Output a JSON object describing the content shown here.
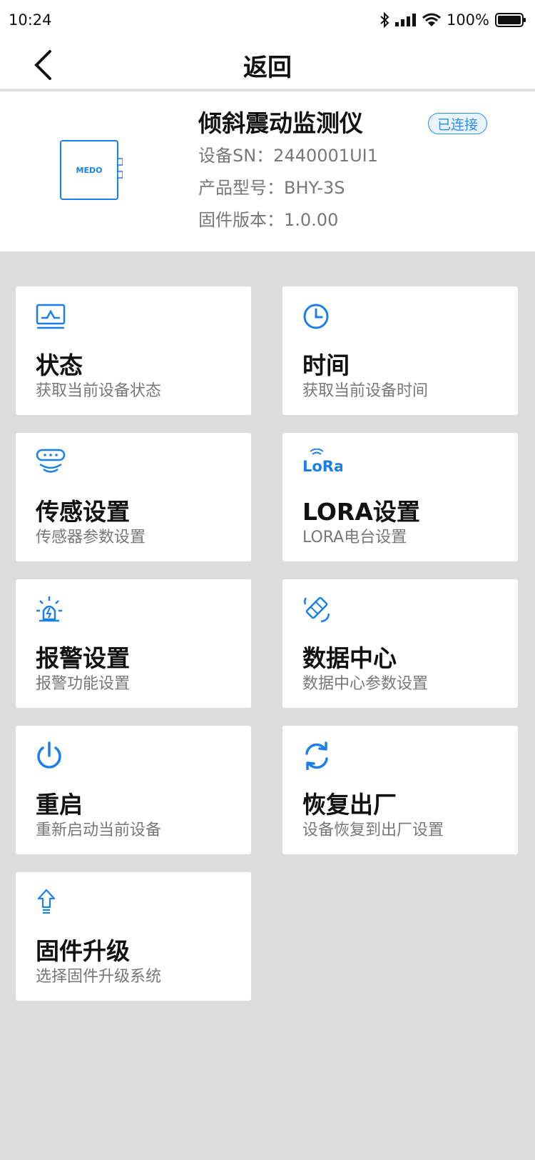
{
  "status_bar": {
    "time": "10:24",
    "battery": "100%"
  },
  "nav": {
    "title": "返回"
  },
  "device": {
    "name": "倾斜震动监测仪",
    "status": "已连接",
    "logo_text": "MEDO",
    "sn": "设备SN：2440001UI1",
    "model": "产品型号：BHY-3S",
    "firmware": "固件版本：1.0.00"
  },
  "accent_color": "#1a7fe8",
  "cards": [
    {
      "title": "状态",
      "subtitle": "获取当前设备状态",
      "icon": "monitor-icon"
    },
    {
      "title": "时间",
      "subtitle": "获取当前设备时间",
      "icon": "clock-icon"
    },
    {
      "title": "传感设置",
      "subtitle": "传感器参数设置",
      "icon": "sensor-icon"
    },
    {
      "title": "LORA设置",
      "subtitle": "LORA电台设置",
      "icon": "lora-icon",
      "icon_text": "LoRa"
    },
    {
      "title": "报警设置",
      "subtitle": "报警功能设置",
      "icon": "alarm-icon"
    },
    {
      "title": "数据中心",
      "subtitle": "数据中心参数设置",
      "icon": "satellite-icon"
    },
    {
      "title": "重启",
      "subtitle": "重新启动当前设备",
      "icon": "power-icon"
    },
    {
      "title": "恢复出厂",
      "subtitle": "设备恢复到出厂设置",
      "icon": "refresh-icon"
    },
    {
      "title": "固件升级",
      "subtitle": "选择固件升级系统",
      "icon": "upgrade-icon"
    }
  ]
}
